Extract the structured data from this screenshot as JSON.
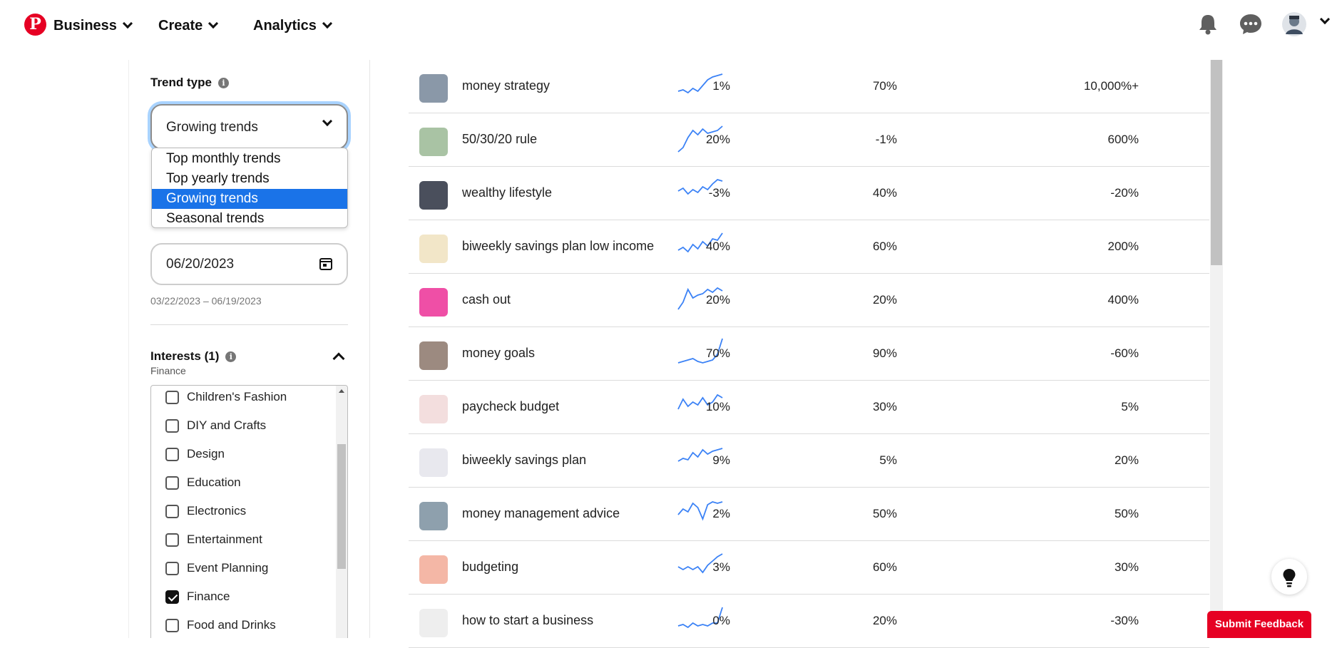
{
  "header": {
    "logo_letter": "P",
    "nav": [
      {
        "label": "Business"
      },
      {
        "label": "Create"
      },
      {
        "label": "Analytics"
      }
    ],
    "icons": [
      "bell-icon",
      "messages-icon",
      "avatar",
      "chevron-down-icon"
    ]
  },
  "filters": {
    "trend_type_label": "Trend type",
    "info_glyph": "i",
    "trend_type_value": "Growing trends",
    "trend_type_options": [
      "Top monthly trends",
      "Top yearly trends",
      "Growing trends",
      "Seasonal trends"
    ],
    "date_value": "06/20/2023",
    "date_range": "03/22/2023 – 06/19/2023",
    "interests_label": "Interests (1)",
    "interests_sub": "Finance",
    "interests": [
      {
        "label": "Children's Fashion",
        "checked": false
      },
      {
        "label": "DIY and Crafts",
        "checked": false
      },
      {
        "label": "Design",
        "checked": false
      },
      {
        "label": "Education",
        "checked": false
      },
      {
        "label": "Electronics",
        "checked": false
      },
      {
        "label": "Entertainment",
        "checked": false
      },
      {
        "label": "Event Planning",
        "checked": false
      },
      {
        "label": "Finance",
        "checked": true
      },
      {
        "label": "Food and Drinks",
        "checked": false
      }
    ]
  },
  "trends": [
    {
      "keyword": "money strategy",
      "col1": "1%",
      "col2": "70%",
      "col3": "10,000%+",
      "thumb_color": "#8a98a8",
      "spark": [
        30,
        28,
        32,
        26,
        30,
        22,
        14,
        10,
        8,
        6
      ]
    },
    {
      "keyword": "50/30/20 rule",
      "col1": "20%",
      "col2": "-1%",
      "col3": "600%",
      "thumb_color": "#a9c3a4",
      "spark": [
        40,
        34,
        20,
        10,
        16,
        8,
        14,
        12,
        10,
        4
      ]
    },
    {
      "keyword": "wealthy lifestyle",
      "col1": "-3%",
      "col2": "40%",
      "col3": "-20%",
      "thumb_color": "#4a4f5c",
      "spark": [
        20,
        16,
        24,
        18,
        22,
        14,
        18,
        10,
        4,
        6
      ]
    },
    {
      "keyword": "biweekly savings plan low income",
      "col1": "40%",
      "col2": "60%",
      "col3": "200%",
      "thumb_color": "#f2e6c8",
      "spark": [
        28,
        24,
        30,
        20,
        26,
        16,
        22,
        12,
        14,
        4
      ]
    },
    {
      "keyword": "cash out",
      "col1": "20%",
      "col2": "20%",
      "col3": "400%",
      "thumb_color": "#ef4fa6",
      "spark": [
        36,
        26,
        8,
        20,
        16,
        14,
        8,
        12,
        6,
        10
      ]
    },
    {
      "keyword": "money goals",
      "col1": "70%",
      "col2": "90%",
      "col3": "-60%",
      "thumb_color": "#9c8a80",
      "spark": [
        36,
        34,
        32,
        30,
        34,
        36,
        34,
        32,
        24,
        2
      ]
    },
    {
      "keyword": "paycheck budget",
      "col1": "10%",
      "col2": "30%",
      "col3": "5%",
      "thumb_color": "#f3dede",
      "spark": [
        26,
        12,
        22,
        16,
        20,
        10,
        20,
        16,
        6,
        10
      ]
    },
    {
      "keyword": "biweekly savings plan",
      "col1": "9%",
      "col2": "5%",
      "col3": "20%",
      "thumb_color": "#e8e8ee",
      "spark": [
        24,
        20,
        22,
        12,
        18,
        8,
        14,
        10,
        8,
        6
      ]
    },
    {
      "keyword": "money management advice",
      "col1": "2%",
      "col2": "50%",
      "col3": "50%",
      "thumb_color": "#8ea0ad",
      "spark": [
        24,
        16,
        20,
        8,
        14,
        30,
        10,
        6,
        8,
        6
      ]
    },
    {
      "keyword": "budgeting",
      "col1": "3%",
      "col2": "60%",
      "col3": "30%",
      "thumb_color": "#f4b7a6",
      "spark": [
        22,
        26,
        22,
        26,
        22,
        30,
        20,
        14,
        8,
        4
      ]
    },
    {
      "keyword": "how to start a business",
      "col1": "0%",
      "col2": "20%",
      "col3": "-30%",
      "thumb_color": "#eeeeee",
      "spark": [
        30,
        28,
        32,
        26,
        30,
        28,
        30,
        26,
        26,
        4
      ]
    }
  ],
  "lightbulb_icon": "lightbulb-icon",
  "feedback_label": "Submit Feedback",
  "accent_color": "#e60023",
  "select_highlight": "#1a73e8",
  "spark_color": "#3b82f6"
}
